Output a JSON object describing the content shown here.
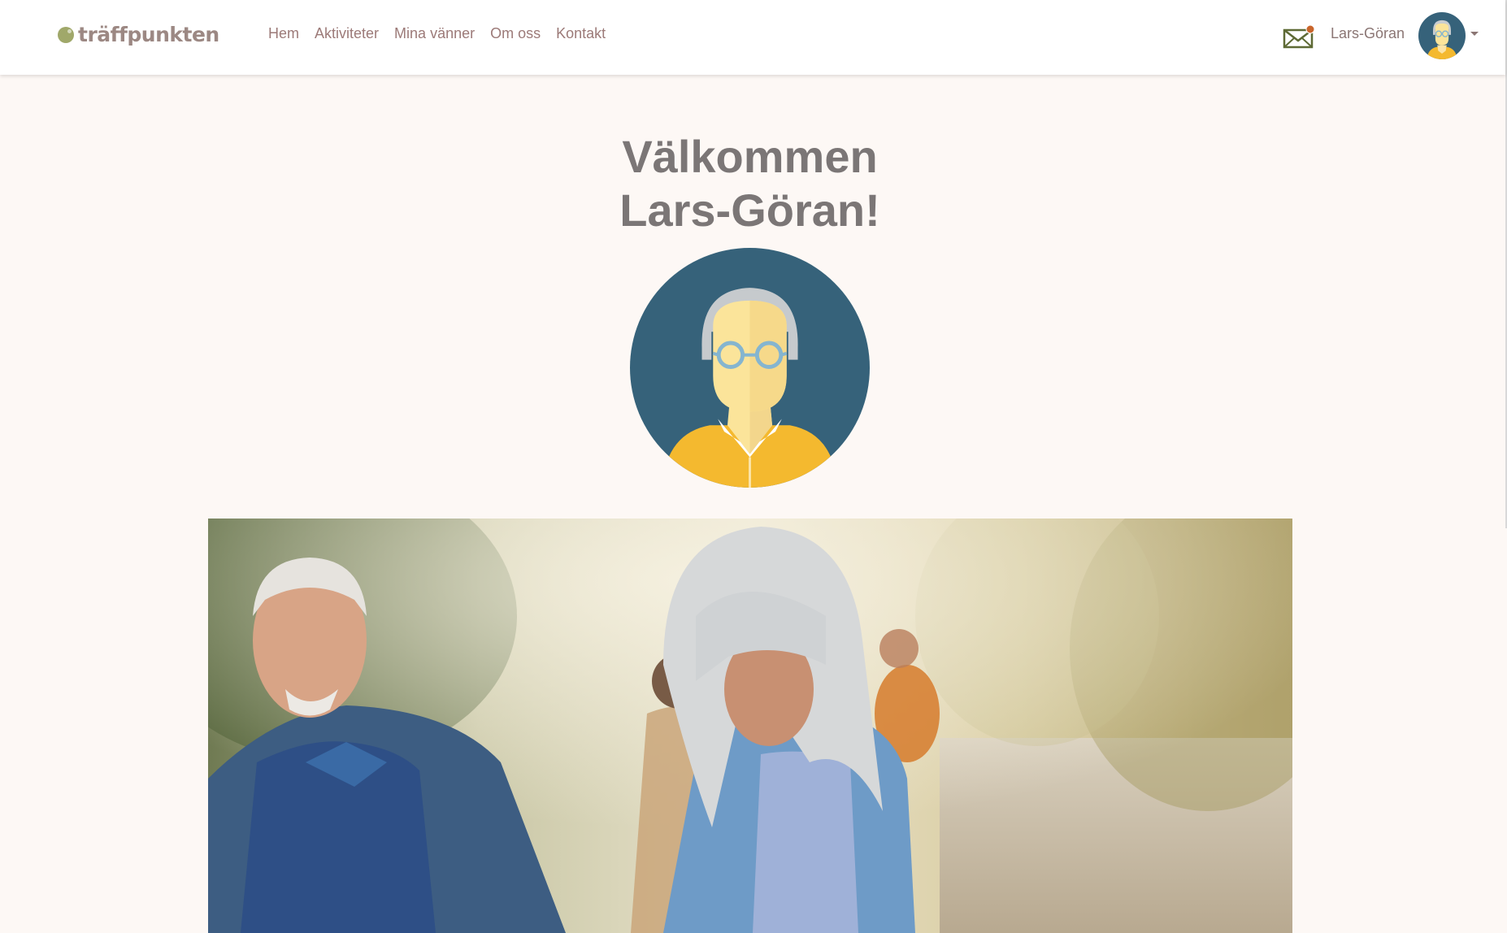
{
  "header": {
    "logo_text": "träffpunkten",
    "nav": [
      {
        "label": "Hem"
      },
      {
        "label": "Aktiviteter"
      },
      {
        "label": "Mina vänner"
      },
      {
        "label": "Om oss"
      },
      {
        "label": "Kontakt"
      }
    ],
    "mail_icon": "envelope-icon",
    "user_name": "Lars-Göran"
  },
  "main": {
    "welcome_line1": "Välkommen",
    "welcome_line2": "Lars-Göran!"
  },
  "colors": {
    "page_bg": "#fdf8f5",
    "nav_link": "#9c7a78",
    "logo_green": "#a0a86a",
    "avatar_bg": "#36627a",
    "avatar_shirt": "#f4b92f",
    "heading": "#7b7676"
  }
}
